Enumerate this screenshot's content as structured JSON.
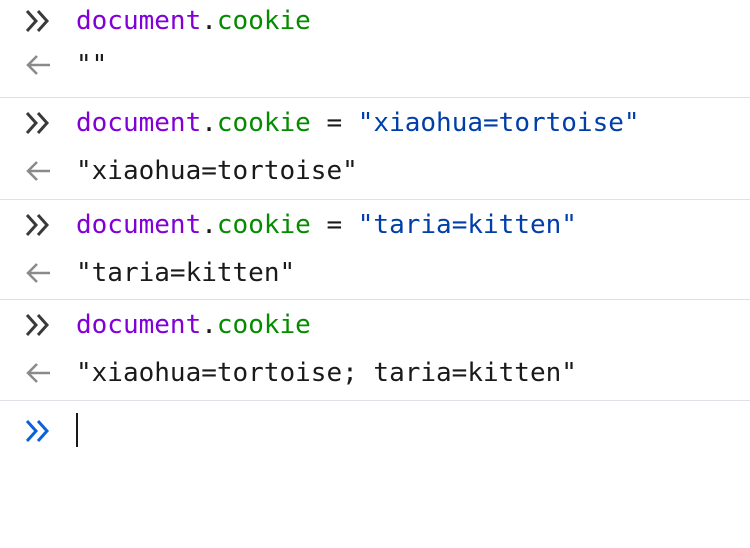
{
  "entries": [
    {
      "input": {
        "object": "document",
        "dot": ".",
        "property": "cookie",
        "operator": "",
        "string": ""
      },
      "output": "\"\""
    },
    {
      "input": {
        "object": "document",
        "dot": ".",
        "property": "cookie",
        "operator": " = ",
        "string": "\"xiaohua=tortoise\""
      },
      "output": "\"xiaohua=tortoise\""
    },
    {
      "input": {
        "object": "document",
        "dot": ".",
        "property": "cookie",
        "operator": " = ",
        "string": "\"taria=kitten\""
      },
      "output": "\"taria=kitten\""
    },
    {
      "input": {
        "object": "document",
        "dot": ".",
        "property": "cookie",
        "operator": "",
        "string": ""
      },
      "output": "\"xiaohua=tortoise; taria=kitten\""
    }
  ],
  "prompt": {
    "value": "",
    "icon": "double-chevron-right-icon"
  },
  "icons": {
    "input": "double-chevron-right-icon",
    "output": "left-arrow-icon"
  },
  "colors": {
    "object": "#8000d7",
    "property": "#058b00",
    "string": "#003eaa",
    "prompt_accent": "#0a62d8",
    "gutter_icon": "#3a3a3a",
    "output_arrow": "#8a8a8a"
  }
}
